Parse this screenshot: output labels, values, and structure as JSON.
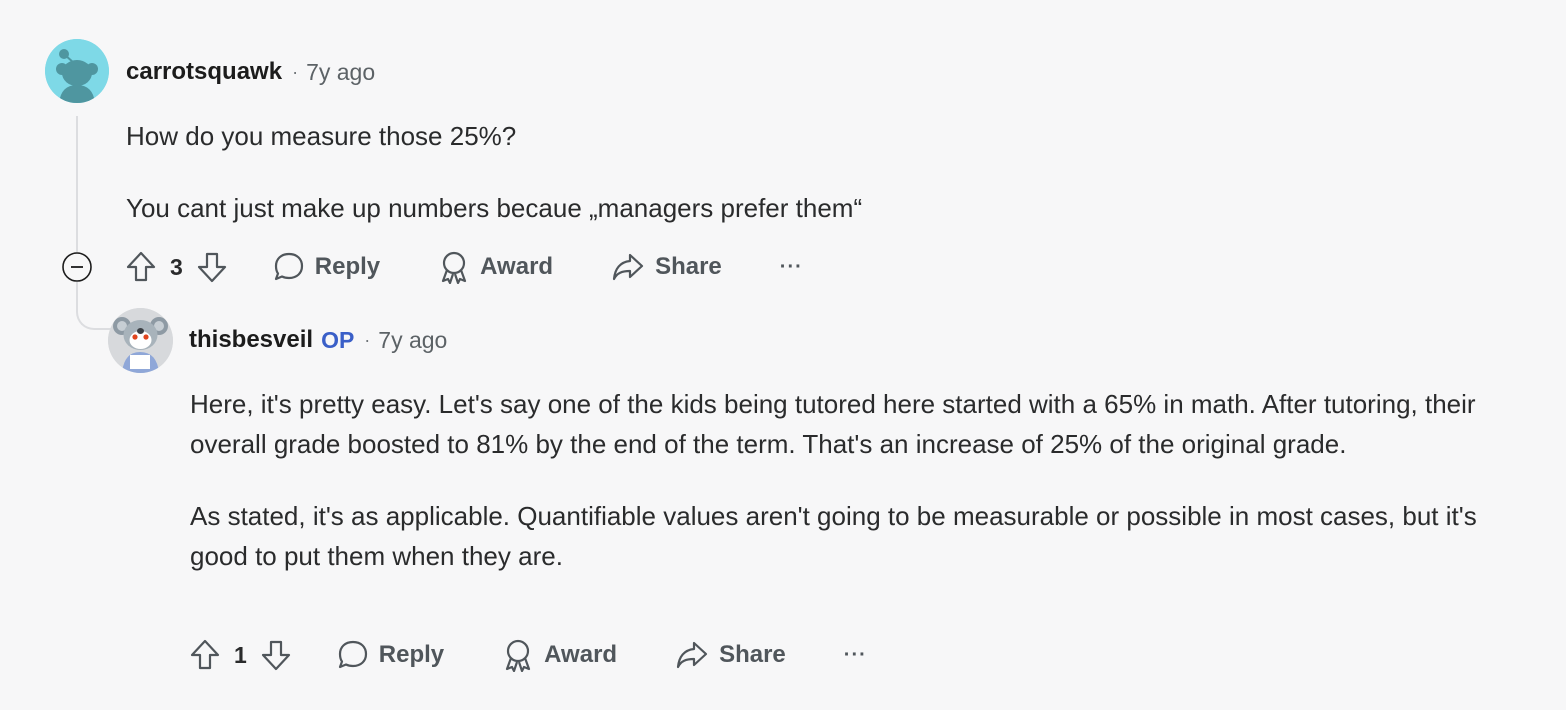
{
  "comments": [
    {
      "username": "carrotsquawk",
      "separator": "·",
      "time": "7y ago",
      "paragraphs": [
        "How do you measure those 25%?",
        "You cant just make up numbers becaue „managers prefer them“"
      ],
      "votes": "3",
      "actions": {
        "reply": "Reply",
        "award": "Award",
        "share": "Share",
        "more": "···"
      }
    },
    {
      "username": "thisbesveil",
      "badge": "OP",
      "separator": "·",
      "time": "7y ago",
      "paragraphs": [
        "Here, it's pretty easy. Let's say one of the kids being tutored here started with a 65% in math. After tutoring, their overall grade boosted to 81% by the end of the term. That's an increase of 25% of the original grade.",
        "As stated, it's as applicable. Quantifiable values aren't going to be measurable or possible in most cases, but it's good to put them when they are."
      ],
      "votes": "1",
      "actions": {
        "reply": "Reply",
        "award": "Award",
        "share": "Share",
        "more": "···"
      }
    }
  ],
  "colors": {
    "background": "#f7f7f8",
    "op_badge": "#3a5fc8",
    "avatar1_bg": "#7ed9e7",
    "avatar2_bg": "#d7d9dc"
  },
  "icons": [
    "snoo-avatar-icon",
    "koala-avatar-icon",
    "upvote-icon",
    "downvote-icon",
    "reply-bubble-icon",
    "award-icon",
    "share-arrow-icon",
    "collapse-minus-icon"
  ]
}
